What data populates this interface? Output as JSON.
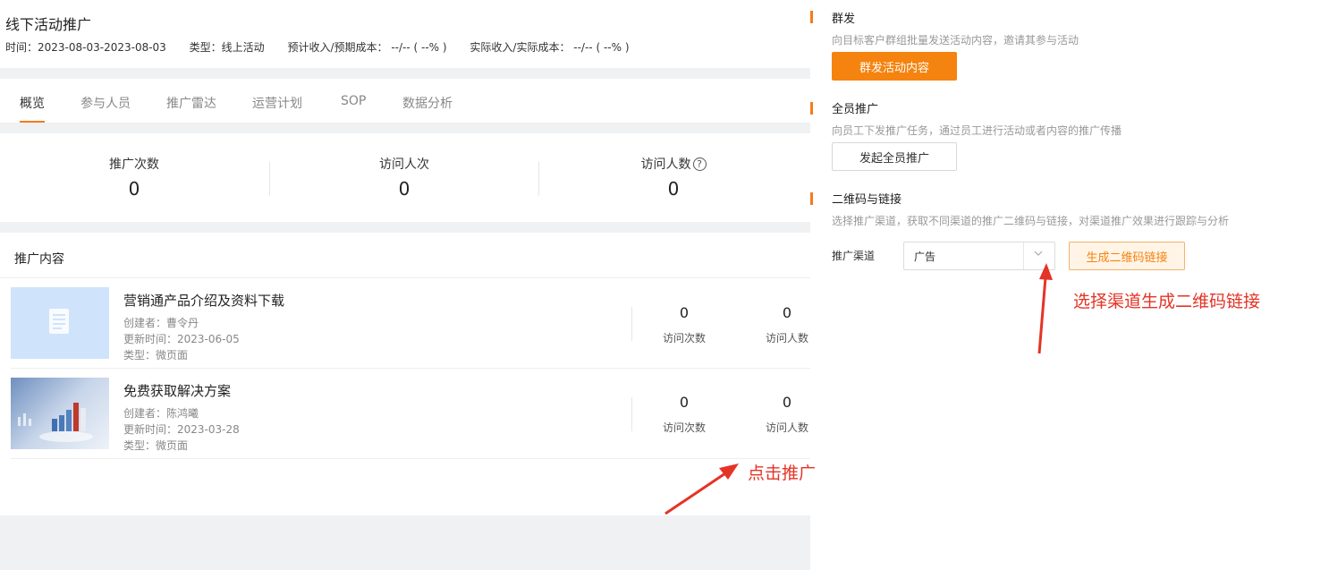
{
  "activity": {
    "title": "线下活动推广",
    "time": "时间：2023-08-03-2023-08-03",
    "type": "类型：线上活动",
    "expected": "预计收入/预期成本：  --/-- ( --% )",
    "actual": "实际收入/实际成本：  --/-- ( --% )"
  },
  "tabs": [
    {
      "label": "概览",
      "active": true
    },
    {
      "label": "参与人员"
    },
    {
      "label": "推广雷达"
    },
    {
      "label": "运营计划"
    },
    {
      "label": "SOP"
    },
    {
      "label": "数据分析"
    }
  ],
  "stats": [
    {
      "label": "推广次数",
      "value": "0"
    },
    {
      "label": "访问人次",
      "value": "0"
    },
    {
      "label": "访问人数",
      "value": "0",
      "help": "?"
    }
  ],
  "content": {
    "title": "推广内容",
    "items": [
      {
        "title": "营销通产品介绍及资料下载",
        "creator": "创建者：曹令丹",
        "updated": "更新时间：2023-06-05",
        "type": "类型：微页面",
        "visits": "0",
        "visits_label": "访问次数",
        "visitors": "0",
        "visitors_label": "访问人数",
        "thumb_icon": "document-icon"
      },
      {
        "title": "免费获取解决方案",
        "creator": "创建者：陈鸿曦",
        "updated": "更新时间：2023-03-28",
        "type": "类型：微页面",
        "visits": "0",
        "visits_label": "访问次数",
        "visitors": "0",
        "visitors_label": "访问人数",
        "thumb_icon": "chart-photo"
      }
    ]
  },
  "panel": {
    "mass": {
      "title": "群发",
      "desc": "向目标客户群组批量发送活动内容，邀请其参与活动",
      "button": "群发活动内容"
    },
    "all_staff": {
      "title": "全员推广",
      "desc": "向员工下发推广任务，通过员工进行活动或者内容的推广传播",
      "button": "发起全员推广"
    },
    "qr": {
      "title": "二维码与链接",
      "desc": "选择推广渠道，获取不同渠道的推广二维码与链接，对渠道推广效果进行跟踪与分析",
      "channel_label": "推广渠道",
      "channel_value": "广告",
      "button": "生成二维码链接"
    }
  },
  "annotations": {
    "click_promote": "点击推广",
    "select_channel": "选择渠道生成二维码链接"
  },
  "colors": {
    "accent": "#f5830f",
    "annotation": "#e53326"
  }
}
